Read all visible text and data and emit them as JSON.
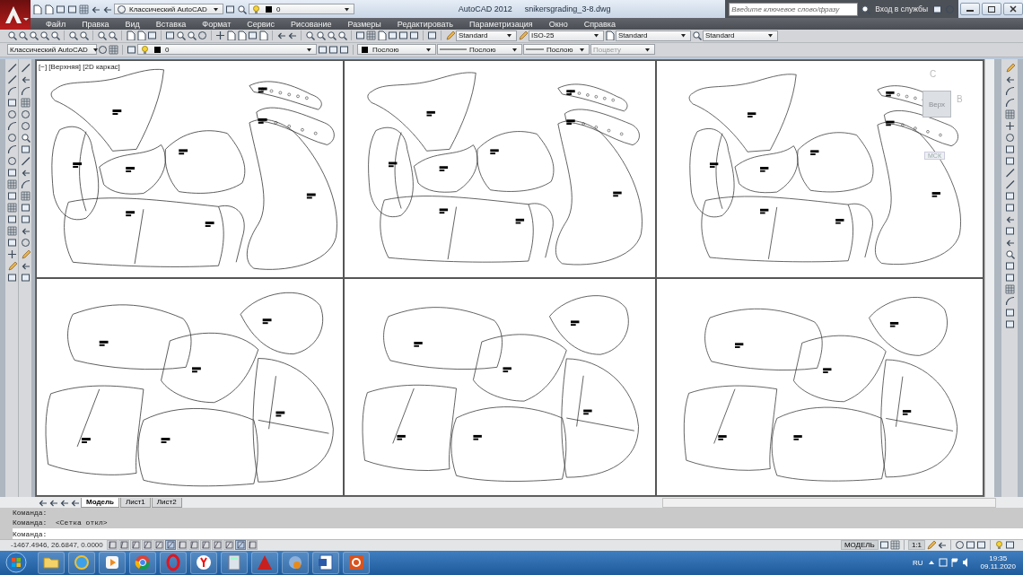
{
  "title_bar": {
    "app_name": "AutoCAD 2012",
    "file_name": "snikersgrading_3-8.dwg",
    "workspace": "Классический AutoCAD",
    "layer": "0",
    "search_placeholder": "Введите ключевое слово/фразу",
    "sign_in": "Вход в службы"
  },
  "menu": [
    "Файл",
    "Правка",
    "Вид",
    "Вставка",
    "Формат",
    "Сервис",
    "Рисование",
    "Размеры",
    "Редактировать",
    "Параметризация",
    "Окно",
    "Справка"
  ],
  "styles_toolbar": [
    "Standard",
    "ISO-25",
    "Standard",
    "Standard"
  ],
  "properties_toolbar": {
    "workspace": "Классический AutoCAD",
    "layer": "0",
    "color_setting": "Послою",
    "linetype": "Послою",
    "lineweight": "Послою",
    "plot_style": {
      "label": "Поцвету",
      "disabled": true
    }
  },
  "viewport": {
    "label": "[−] [Верхняя] [2D каркас]",
    "viewcube": {
      "north": "С",
      "face": "Верх",
      "east": "В",
      "ucs": "МСК"
    }
  },
  "layout_tabs": [
    {
      "label": "Модель",
      "selected": true
    },
    {
      "label": "Лист1",
      "selected": false
    },
    {
      "label": "Лист2",
      "selected": false
    }
  ],
  "command_history": [
    "Команда:",
    "Команда:  <Сетка откл>"
  ],
  "command_prompt": "Команда:",
  "status_bar": {
    "coordinates": "-1467.4946, 26.6847, 0.0000",
    "toggles": [
      {
        "on": false
      },
      {
        "on": false
      },
      {
        "on": false
      },
      {
        "on": false
      },
      {
        "on": false
      },
      {
        "on": true
      },
      {
        "on": false
      },
      {
        "on": false
      },
      {
        "on": false
      },
      {
        "on": false
      },
      {
        "on": false
      },
      {
        "on": true
      },
      {
        "on": false
      }
    ],
    "space": "МОДЕЛЬ",
    "scale": "1:1"
  },
  "taskbar": {
    "apps": [
      {
        "kind": "folder"
      },
      {
        "kind": "globe"
      },
      {
        "kind": "play"
      },
      {
        "kind": "wheel"
      },
      {
        "kind": "ring"
      },
      {
        "kind": "disc"
      },
      {
        "kind": "calculator"
      },
      {
        "kind": "triangle"
      },
      {
        "kind": "orb"
      },
      {
        "kind": "document"
      },
      {
        "kind": "tile"
      }
    ],
    "language": "RU",
    "time": "19:35",
    "date": "09.11.2020"
  }
}
